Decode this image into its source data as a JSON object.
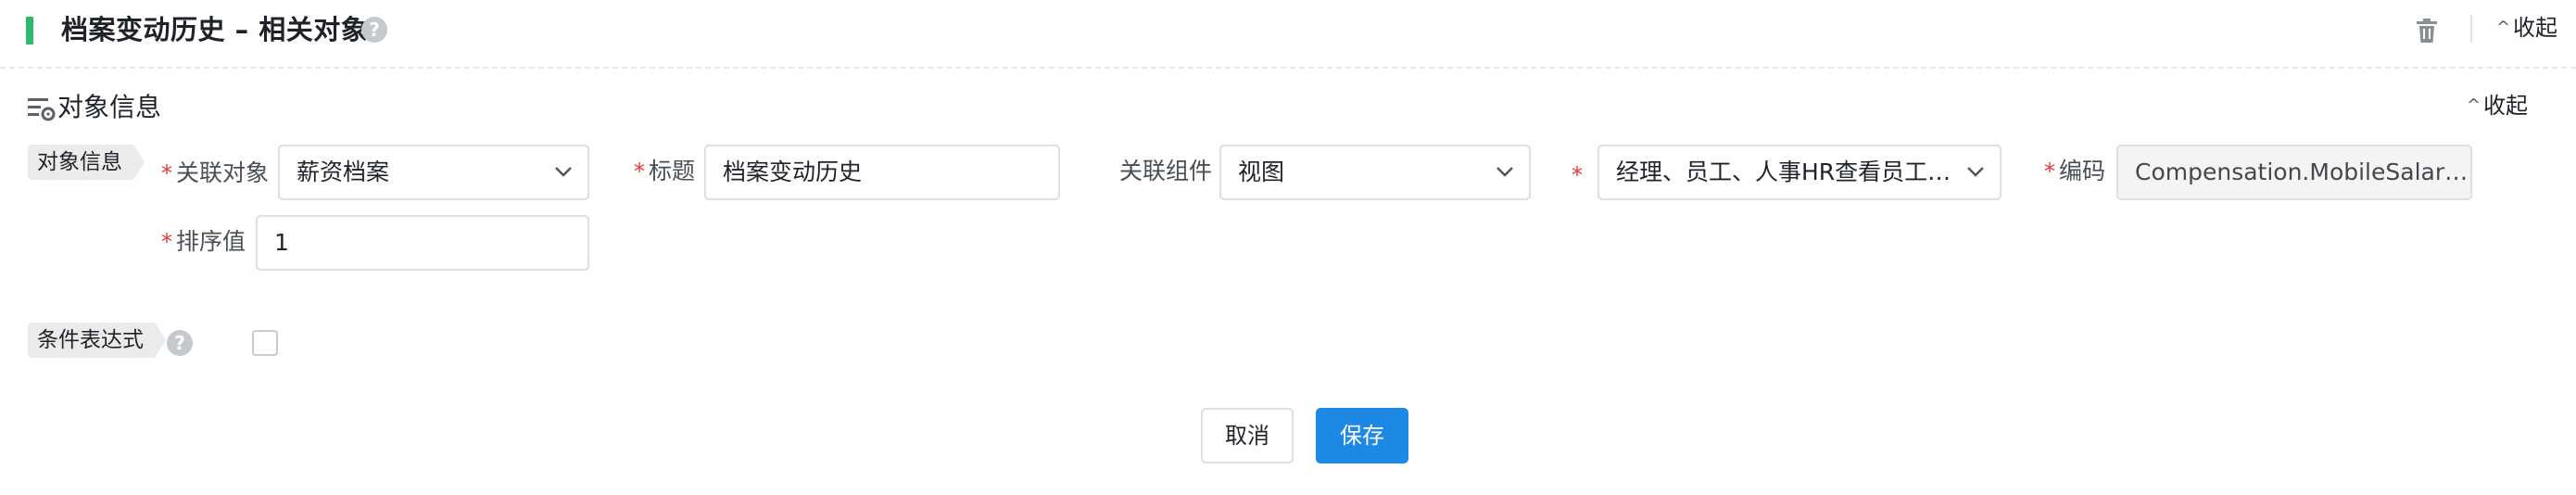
{
  "header": {
    "title": "档案变动历史 – 相关对象",
    "help_glyph": "?",
    "collapse_label": "收起",
    "accent_color": "#2fb96a"
  },
  "section": {
    "title": "对象信息",
    "collapse_label": "收起",
    "tag_label": "对象信息"
  },
  "form": {
    "related_object": {
      "label": "关联对象",
      "value": "薪资档案"
    },
    "title_field": {
      "label": "标题",
      "value": "档案变动历史"
    },
    "related_component": {
      "label": "关联组件",
      "value": "视图"
    },
    "view_select": {
      "value": "经理、员工、人事HR查看员工档..."
    },
    "code_field": {
      "label": "编码",
      "value": "Compensation.MobileSalary..."
    },
    "sort_value": {
      "label": "排序值",
      "value": "1"
    }
  },
  "condition": {
    "tag_label": "条件表达式",
    "help_glyph": "?",
    "checked": false
  },
  "buttons": {
    "cancel_label": "取消",
    "save_label": "保存",
    "primary_color": "#1e88e5"
  },
  "icons": {
    "help": "question-circle-icon",
    "trash": "trash-icon",
    "collapse": "chevron-up-icon",
    "section": "list-settings-icon",
    "dropdown": "chevron-down-icon"
  }
}
